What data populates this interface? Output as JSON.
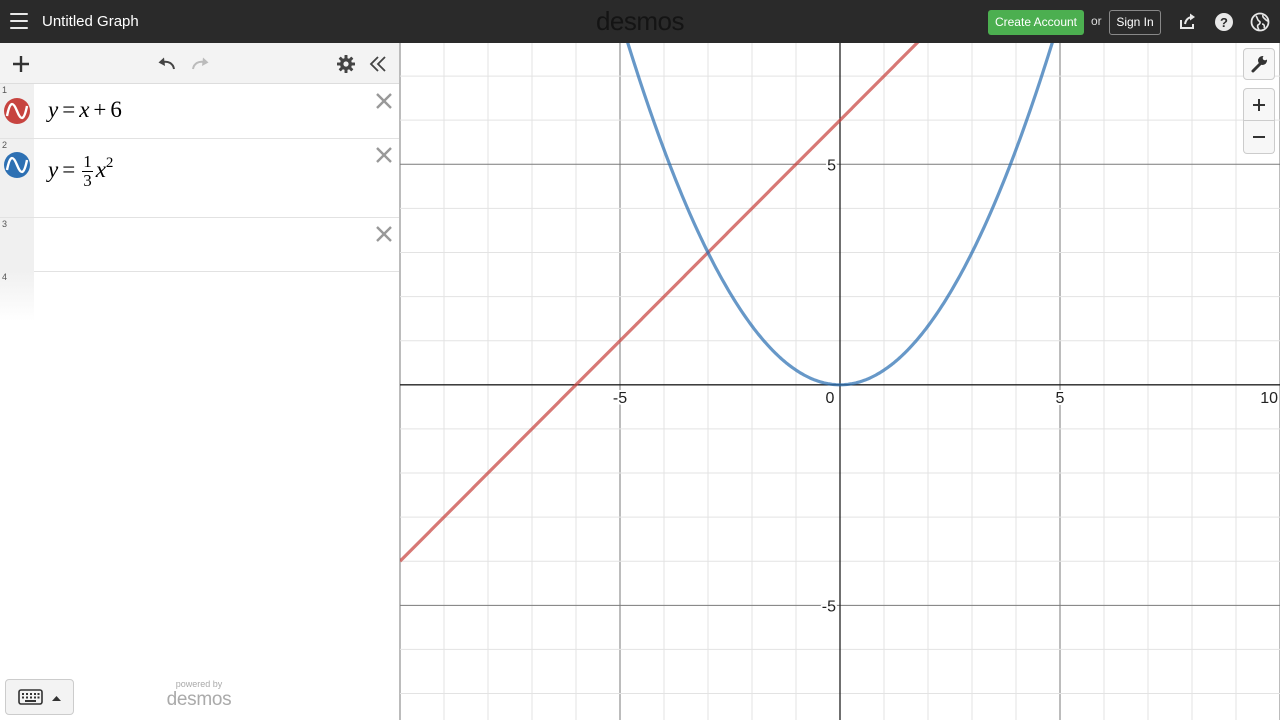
{
  "header": {
    "title": "Untitled Graph",
    "brand": "desmos",
    "create_account": "Create Account",
    "or": "or",
    "sign_in": "Sign In"
  },
  "expressions": [
    {
      "index": "1",
      "latex": "y = x + 6",
      "color": "#c74440"
    },
    {
      "index": "2",
      "latex": "y = \\frac{1}{3}x^2",
      "color": "#2d70b3"
    },
    {
      "index": "3",
      "latex": ""
    },
    {
      "index": "4",
      "latex": ""
    }
  ],
  "expr_text": {
    "e1": {
      "y": "y",
      "eq": "=",
      "x": "x",
      "plus": "+",
      "c": "6"
    },
    "e2": {
      "y": "y",
      "eq": "=",
      "num": "1",
      "den": "3",
      "x": "x",
      "exp": "2"
    }
  },
  "footer": {
    "powered_by": "powered by",
    "logo": "desmos"
  },
  "colors": {
    "accent_green": "#4caf50",
    "line_red": "#c74440",
    "parabola_blue": "#2d70b3"
  },
  "chart_data": {
    "type": "line",
    "xlim": [
      -10,
      10
    ],
    "ylim": [
      -7.6,
      7.75
    ],
    "x_ticks": [
      -5,
      0,
      5,
      10
    ],
    "y_ticks": [
      5,
      -5
    ],
    "tick_labels": {
      "x": [
        "-5",
        "0",
        "5",
        "10"
      ],
      "y": [
        "5",
        "-5"
      ]
    },
    "grid": true,
    "minor_step": 1,
    "major_step": 5,
    "series": [
      {
        "expression": "y = x + 6",
        "slope": 1,
        "intercept": 6,
        "color": "#c74440"
      },
      {
        "expression": "y = 1/3 x^2",
        "coefficient": 0.3333,
        "color": "#2d70b3"
      }
    ]
  }
}
